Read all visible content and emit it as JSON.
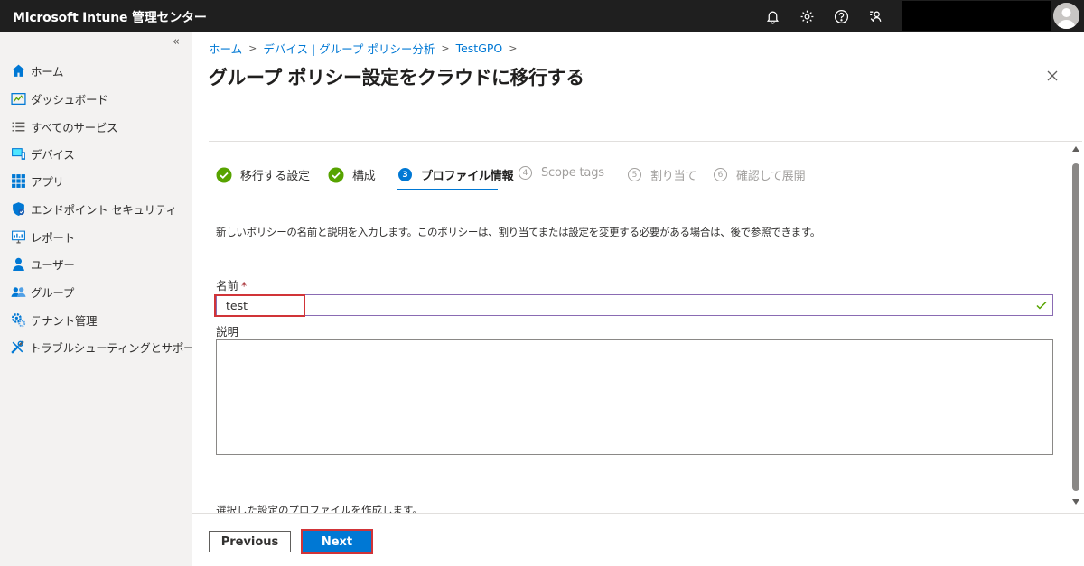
{
  "app": {
    "title": "Microsoft Intune 管理センター"
  },
  "topbar": {
    "icons": [
      "bell-icon",
      "gear-icon",
      "help-icon",
      "feedback-icon"
    ],
    "accent": "#1f1f1f"
  },
  "sidebar": {
    "collapse_glyph": "«",
    "items": [
      {
        "label": "ホーム",
        "icon": "home-icon"
      },
      {
        "label": "ダッシュボード",
        "icon": "dashboard-icon"
      },
      {
        "label": "すべてのサービス",
        "icon": "list-icon"
      },
      {
        "label": "デバイス",
        "icon": "devices-icon"
      },
      {
        "label": "アプリ",
        "icon": "apps-icon"
      },
      {
        "label": "エンドポイント セキュリティ",
        "icon": "shield-icon"
      },
      {
        "label": "レポート",
        "icon": "report-icon"
      },
      {
        "label": "ユーザー",
        "icon": "user-icon"
      },
      {
        "label": "グループ",
        "icon": "group-icon"
      },
      {
        "label": "テナント管理",
        "icon": "tenant-icon"
      },
      {
        "label": "トラブルシューティングとサポート",
        "icon": "tools-icon"
      }
    ]
  },
  "breadcrumb": {
    "items": [
      "ホーム",
      "デバイス | グループ ポリシー分析",
      "TestGPO"
    ]
  },
  "page": {
    "title": "グループ ポリシー設定をクラウドに移行する",
    "more": "···"
  },
  "wizard": {
    "steps": [
      {
        "number": "",
        "label": "移行する設定",
        "state": "complete"
      },
      {
        "number": "",
        "label": "構成",
        "state": "complete"
      },
      {
        "number": "3",
        "label": "プロファイル情報",
        "state": "active"
      },
      {
        "number": "4",
        "label": "Scope tags",
        "state": "disabled"
      },
      {
        "number": "5",
        "label": "割り当て",
        "state": "disabled"
      },
      {
        "number": "6",
        "label": "確認して展開",
        "state": "disabled"
      }
    ],
    "accent": "#0078d4",
    "complete_color": "#57a300"
  },
  "form": {
    "description": "新しいポリシーの名前と説明を入力します。このポリシーは、割り当てまたは設定を変更する必要がある場合は、後で参照できます。",
    "name_label": "名前",
    "required_mark": "*",
    "name_value": "test",
    "desc_label": "説明",
    "desc_value": "",
    "footer_note": "選択した設定のプロファイルを作成します。"
  },
  "footer": {
    "previous_label": "Previous",
    "next_label": "Next"
  },
  "highlight_color": "#d13438"
}
